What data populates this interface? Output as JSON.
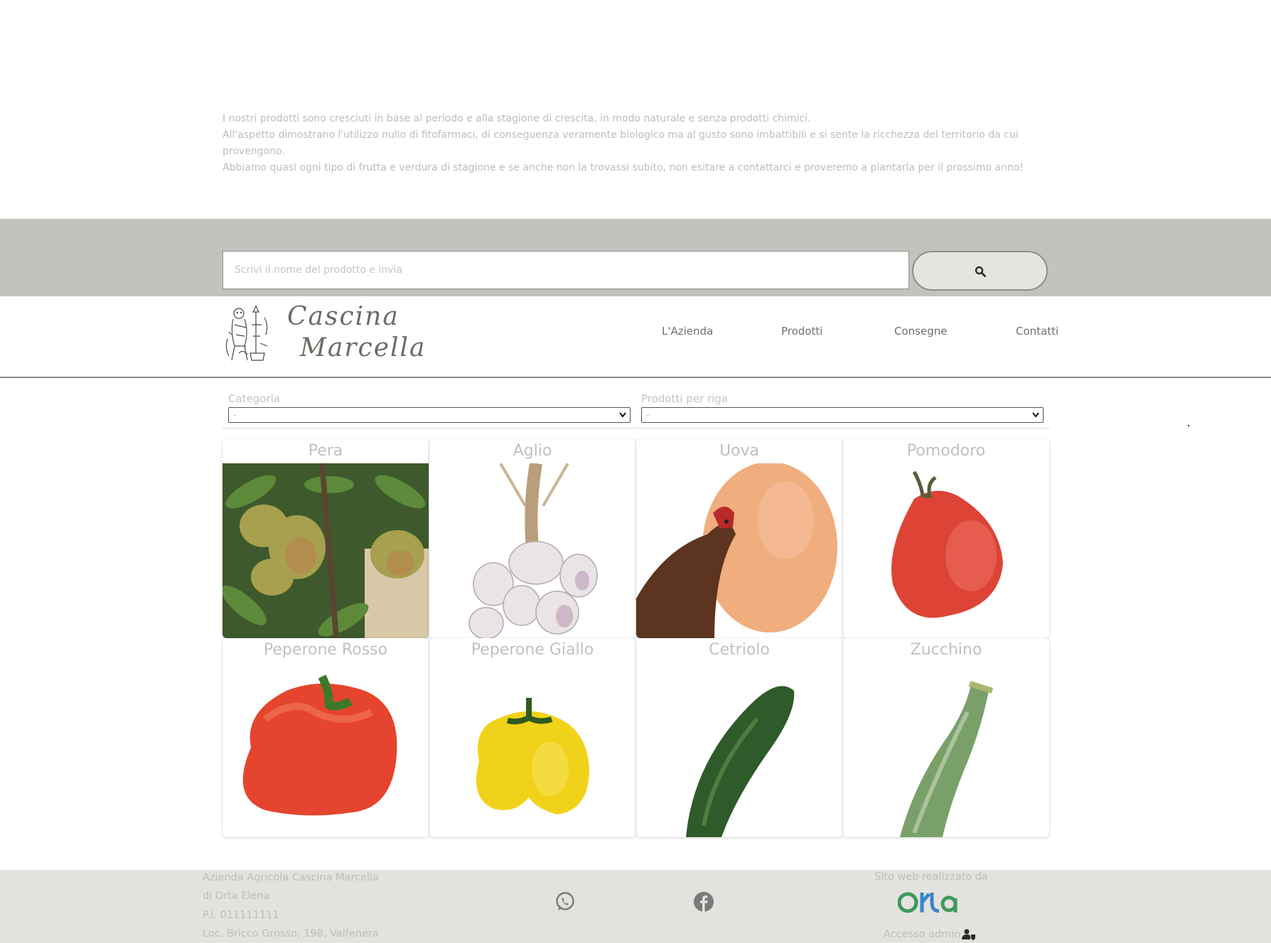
{
  "intro": {
    "line1": "I nostri prodotti sono cresciuti in base al periodo e alla stagione di crescita, in modo naturale e senza prodotti chimici.",
    "line2": "All'aspetto dimostrano l'utilizzo nullo di fitofarmaci, di conseguenza veramente biologico ma al gusto sono imbattibili e si sente la ricchezza del territorio da cui provengono.",
    "line3": "Abbiamo quasi ogni tipo di frutta e verdura di stagione e se anche non la trovassi subito, non esitare a contattarci e proveremo a piantarla per il prossimo anno!"
  },
  "search": {
    "placeholder": "Scrivi il nome del prodotto e invia",
    "button_icon": "search-icon"
  },
  "brand": {
    "line1": "Cascina",
    "line2": "Marcella"
  },
  "nav": {
    "azienda": "L'Azienda",
    "prodotti": "Prodotti",
    "consegne": "Consegne",
    "contatti": "Contatti"
  },
  "filters": {
    "category_label": "Categoria",
    "category_value": "-",
    "per_row_label": "Prodotti per riga",
    "per_row_value": "-"
  },
  "products": [
    {
      "name": "Pera"
    },
    {
      "name": "Aglio"
    },
    {
      "name": "Uova"
    },
    {
      "name": "Pomodoro"
    },
    {
      "name": "Peperone Rosso"
    },
    {
      "name": "Peperone Giallo"
    },
    {
      "name": "Cetriolo"
    },
    {
      "name": "Zucchino"
    }
  ],
  "footer": {
    "company": "Azienda Agricola Cascina Marcella",
    "owner": "di Orta Elena",
    "vat": "P.I. 011111111",
    "address": "Loc. Bricco Grosso, 198, Valfenera",
    "credit": "Sito web realizzato da",
    "credit_logo": "Orta",
    "admin": "Accesso admin",
    "icons": [
      "whatsapp-icon",
      "facebook-icon",
      "admin-user-icon"
    ]
  },
  "colors": {
    "band": "#c4c2bd",
    "footer": "#e3e2de",
    "button": "#e6e4df"
  }
}
